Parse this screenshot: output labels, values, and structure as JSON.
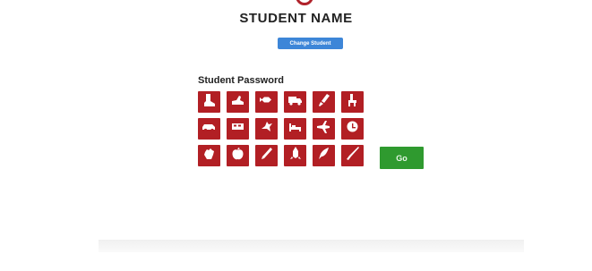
{
  "header": {
    "student_name": "STUDENT NAME",
    "change_button_label": "Change Student"
  },
  "password": {
    "label": "Student Password",
    "tiles": [
      {
        "icon": "boot-icon"
      },
      {
        "icon": "shoe-icon"
      },
      {
        "icon": "fish-icon"
      },
      {
        "icon": "truck-icon"
      },
      {
        "icon": "brush-icon"
      },
      {
        "icon": "chair-icon"
      },
      {
        "icon": "car-icon"
      },
      {
        "icon": "bus-icon"
      },
      {
        "icon": "bird-icon"
      },
      {
        "icon": "bed-icon"
      },
      {
        "icon": "plane-icon"
      },
      {
        "icon": "clock-icon"
      },
      {
        "icon": "hand-icon"
      },
      {
        "icon": "apple-icon"
      },
      {
        "icon": "pencil-icon"
      },
      {
        "icon": "rocket-icon"
      },
      {
        "icon": "feather-icon"
      },
      {
        "icon": "knife-icon"
      }
    ]
  },
  "go_button_label": "Go",
  "colors": {
    "tile": "#b21f24",
    "go": "#2f9a2f",
    "change_button": "#3d86d8"
  }
}
